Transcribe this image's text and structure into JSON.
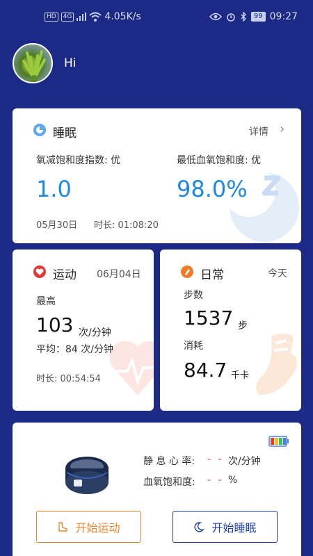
{
  "statusbar": {
    "hd": "HD",
    "net": "4G",
    "speed": "4.05K/s",
    "battery": "99",
    "time": "09:27"
  },
  "user": {
    "greeting": "Hi"
  },
  "sleep_card": {
    "title": "睡眠",
    "details": "详情",
    "odi_label": "氧减饱和度指数: 优",
    "odi_value": "1.0",
    "min_spo2_label": "最低血氧饱和度: 优",
    "min_spo2_value": "98.0%",
    "date": "05月30日",
    "duration": "时长: 01:08:20",
    "accent": "#1e88e5"
  },
  "sport_card": {
    "title": "运动",
    "date": "06月04日",
    "max_label": "最高",
    "max_value": "103",
    "max_unit": "次/分钟",
    "avg": "平均：84 次/分钟",
    "duration": "时长: 00:54:54",
    "icon_color": "#e53935"
  },
  "daily_card": {
    "title": "日常",
    "today": "今天",
    "steps_label": "步数",
    "steps_value": "1537",
    "steps_unit": "步",
    "calories_label": "消耗",
    "calories_value": "84.7",
    "calories_unit": "千卡",
    "icon_color": "#f07a2b"
  },
  "device_card": {
    "rest_hr_label": "静 息 心 率:",
    "rest_hr_value": "- -",
    "rest_hr_unit": "次/分钟",
    "spo2_label": "血氧饱和度:",
    "spo2_value": "- -",
    "spo2_unit": "%",
    "start_sport": "开始运动",
    "start_sleep": "开始睡眠",
    "sport_color": "#e8862f",
    "sleep_color": "#1f3fa8"
  }
}
